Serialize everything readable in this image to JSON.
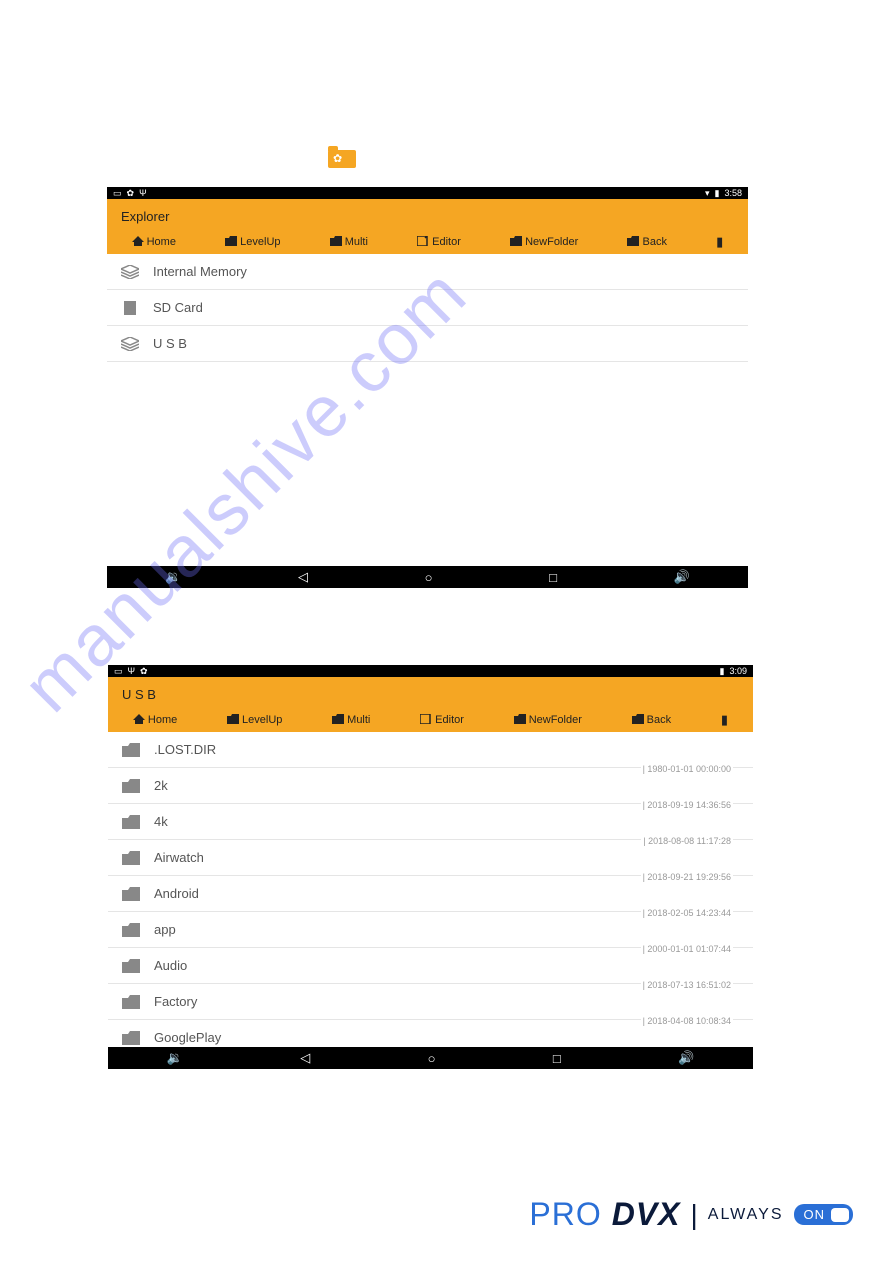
{
  "status1": {
    "time": "3:58"
  },
  "status2": {
    "time": "3:09"
  },
  "header1": {
    "title": "Explorer"
  },
  "header2": {
    "title": "U S B"
  },
  "toolbar": {
    "home": "Home",
    "levelup": "LevelUp",
    "multi": "Multi",
    "editor": "Editor",
    "newfolder": "NewFolder",
    "back": "Back"
  },
  "list1": {
    "items": [
      {
        "label": "Internal Memory",
        "type": "layers"
      },
      {
        "label": "SD Card",
        "type": "sd"
      },
      {
        "label": "U S B",
        "type": "layers"
      }
    ]
  },
  "list2": {
    "items": [
      {
        "label": ".LOST.DIR",
        "meta": "| 1980-01-01 00:00:00"
      },
      {
        "label": "2k",
        "meta": "| 2018-09-19 14:36:56"
      },
      {
        "label": "4k",
        "meta": "| 2018-08-08 11:17:28"
      },
      {
        "label": "Airwatch",
        "meta": "| 2018-09-21 19:29:56"
      },
      {
        "label": "Android",
        "meta": "| 2018-02-05 14:23:44"
      },
      {
        "label": "app",
        "meta": "| 2000-01-01 01:07:44"
      },
      {
        "label": "Audio",
        "meta": "| 2018-07-13 16:51:02"
      },
      {
        "label": "Factory",
        "meta": "| 2018-04-08 10:08:34"
      },
      {
        "label": "GooglePlay",
        "meta": ""
      }
    ]
  },
  "watermark": "manualshive.com",
  "footer": {
    "pro": "PRO",
    "dvx": "DVX",
    "always": "ALWAYS",
    "on": "ON"
  }
}
